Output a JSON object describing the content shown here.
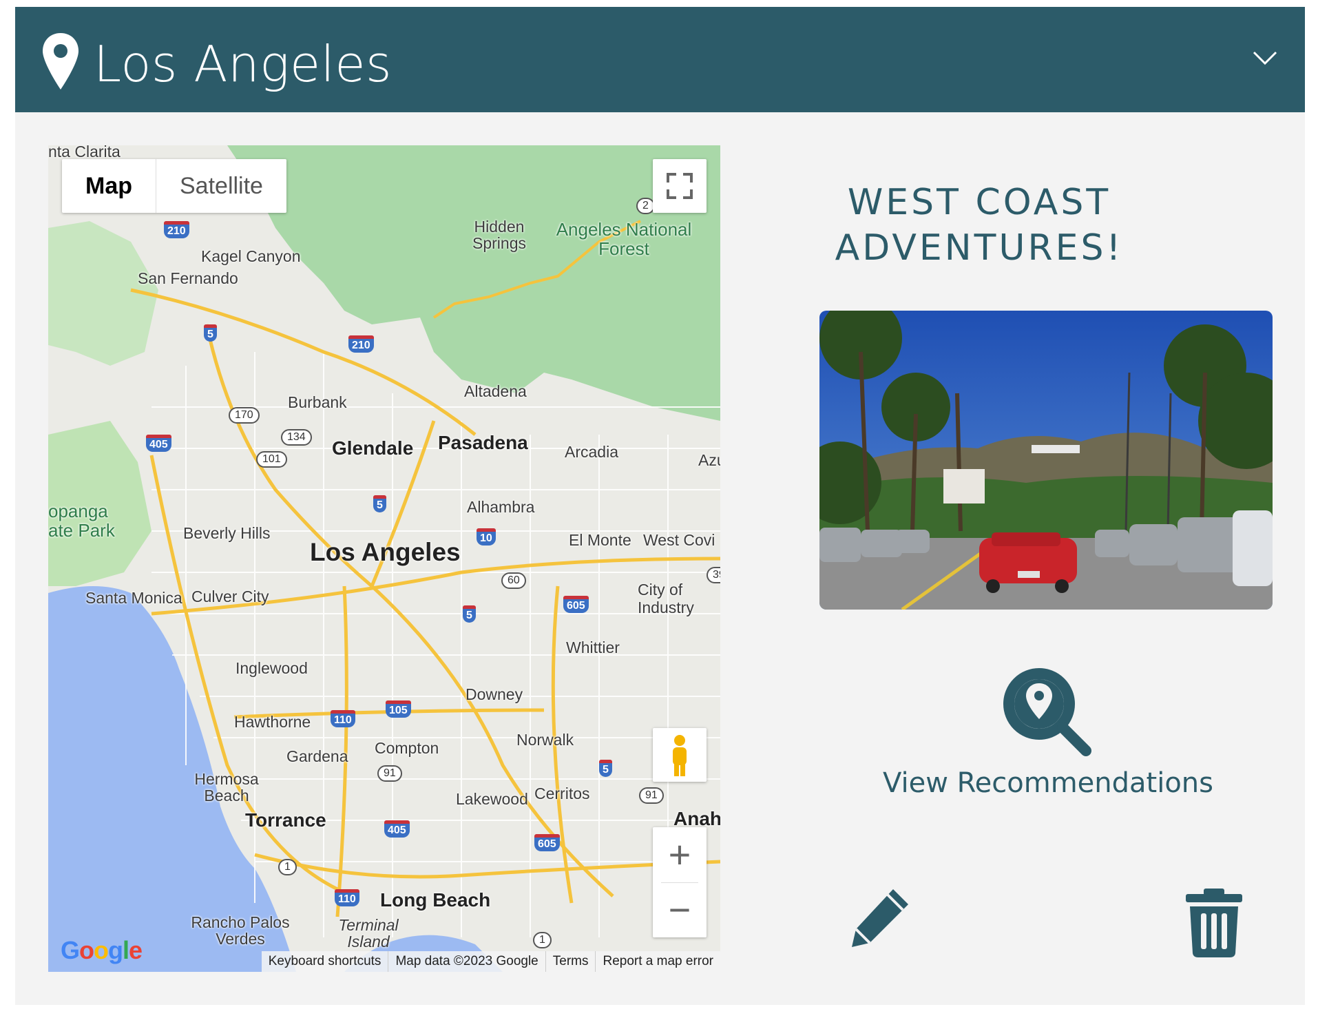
{
  "header": {
    "title": "Los Angeles",
    "pin_icon": "map-pin-icon",
    "toggle_icon": "chevron-down-icon",
    "color": "#2c5b69"
  },
  "map": {
    "type_buttons": {
      "map": "Map",
      "satellite": "Satellite"
    },
    "fullscreen_icon": "fullscreen-icon",
    "pegman_icon": "street-view-pegman-icon",
    "zoom": {
      "in": "+",
      "out": "−"
    },
    "logo": "Google",
    "attribution": {
      "shortcuts": "Keyboard shortcuts",
      "data": "Map data ©2023 Google",
      "terms": "Terms",
      "report": "Report a map error"
    },
    "places": {
      "santa_clarita": "nta Clarita",
      "hidden_springs": "Hidden Springs",
      "angeles_nf": "Angeles National Forest",
      "kagel_canyon": "Kagel Canyon",
      "san_fernando": "San Fernando",
      "altadena": "Altadena",
      "burbank": "Burbank",
      "glendale": "Glendale",
      "pasadena": "Pasadena",
      "arcadia": "Arcadia",
      "azusa": "Azu",
      "topanga": "opanga",
      "state_park": "ate Park",
      "alhambra": "Alhambra",
      "beverly_hills": "Beverly Hills",
      "los_angeles": "Los Angeles",
      "el_monte": "El Monte",
      "west_covina": "West Covi",
      "santa_monica": "Santa Monica",
      "culver_city": "Culver City",
      "city_of_industry": "City of Industry",
      "whittier": "Whittier",
      "inglewood": "Inglewood",
      "downey": "Downey",
      "hawthorne": "Hawthorne",
      "norwalk": "Norwalk",
      "compton": "Compton",
      "gardena": "Gardena",
      "hermosa_beach": "Hermosa Beach",
      "lakewood": "Lakewood",
      "cerritos": "Cerritos",
      "torrance": "Torrance",
      "anaheim": "Anah",
      "long_beach": "Long Beach",
      "rancho_pv": "Rancho Palos Verdes",
      "terminal_island": "Terminal Island"
    },
    "shields": {
      "i210a": "210",
      "i210b": "210",
      "i5a": "5",
      "i5b": "5",
      "i5c": "5",
      "i5d": "5",
      "i405a": "405",
      "i405b": "405",
      "i10": "10",
      "i605a": "605",
      "i605b": "605",
      "i105": "105",
      "i110a": "110",
      "i110b": "110"
    },
    "ovals": {
      "r2": "2",
      "r170": "170",
      "r134": "134",
      "r101": "101",
      "r60": "60",
      "r91a": "91",
      "r91b": "91",
      "r1a": "1",
      "r1b": "1",
      "r39": "39"
    }
  },
  "aside": {
    "headline": "WEST COAST ADVENTURES!",
    "photo_alt": "HOLLYWOOD",
    "recommend": {
      "icon": "search-location-icon",
      "label": "View Recommendations"
    },
    "edit_icon": "pencil-icon",
    "delete_icon": "trash-icon"
  }
}
